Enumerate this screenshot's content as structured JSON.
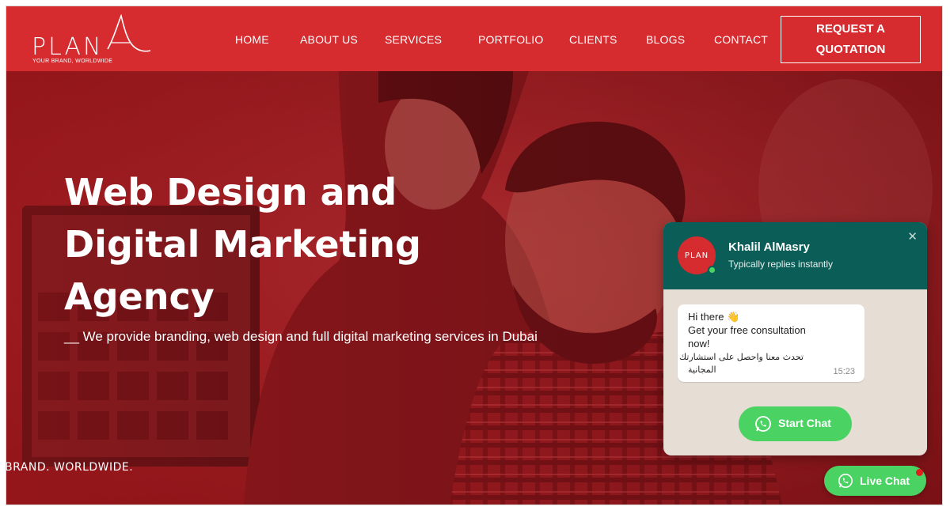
{
  "brand": {
    "logo_text": "PLAN",
    "tagline": "YOUR BRAND, WORLDWIDE"
  },
  "nav": {
    "items": [
      {
        "label": "HOME"
      },
      {
        "label": "ABOUT US"
      },
      {
        "label": "SERVICES"
      },
      {
        "label": "PORTFOLIO"
      },
      {
        "label": "CLIENTS"
      },
      {
        "label": "BLOGS"
      },
      {
        "label": "CONTACT"
      }
    ],
    "cta_line1": "REQUEST A",
    "cta_line2": "QUOTATION"
  },
  "hero": {
    "title_line1": "Web Design and",
    "title_line2": "Digital Marketing",
    "title_line3": "Agency",
    "subtitle": "__ We provide branding, web design and full digital marketing services in Dubai",
    "tag": "BRAND. WORLDWIDE."
  },
  "chat": {
    "agent_name": "Khalil AlMasry",
    "agent_status": "Typically replies instantly",
    "avatar_text": "PLAN",
    "close_icon": "✕",
    "message_line1": "Hi there 👋",
    "message_line2": "Get your free consultation",
    "message_line3": "now!",
    "message_ar1": "تحدث معنا واحصل على استشارتك",
    "message_ar2": "المجانية",
    "time": "15:23",
    "start_label": "Start Chat",
    "live_label": "Live Chat"
  },
  "colors": {
    "brand_red": "#d62b2f",
    "chat_header": "#0b5e57",
    "whatsapp_green": "#4ad363"
  }
}
